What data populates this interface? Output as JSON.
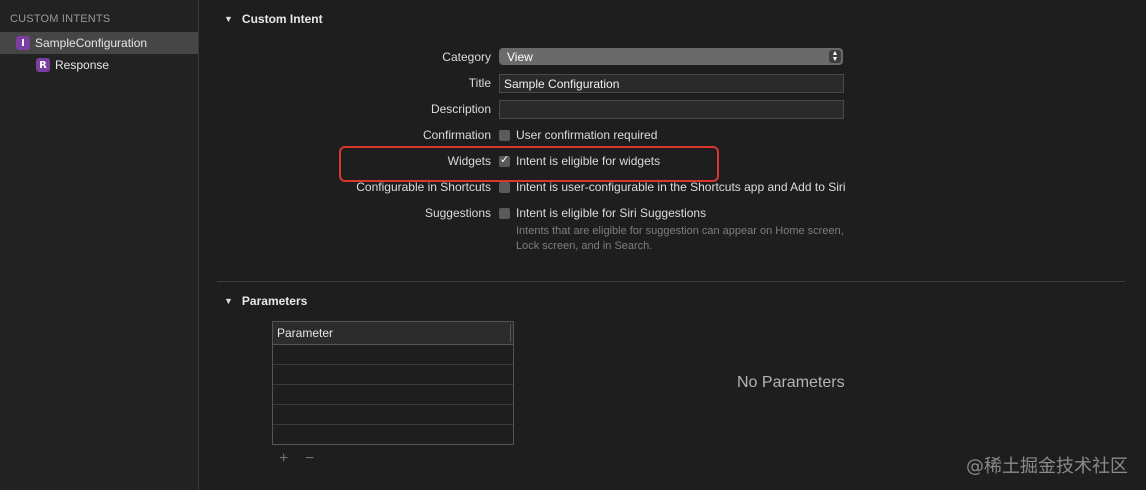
{
  "sidebar": {
    "header": "CUSTOM INTENTS",
    "items": [
      {
        "badge": "I",
        "label": "SampleConfiguration",
        "selected": true
      },
      {
        "badge": "R",
        "label": "Response",
        "selected": false
      }
    ]
  },
  "custom_intent": {
    "section_title": "Custom Intent",
    "category": {
      "label": "Category",
      "value": "View"
    },
    "title": {
      "label": "Title",
      "value": "Sample Configuration"
    },
    "description": {
      "label": "Description",
      "value": ""
    },
    "confirmation": {
      "label": "Confirmation",
      "text": "User confirmation required",
      "checked": false
    },
    "widgets": {
      "label": "Widgets",
      "text": "Intent is eligible for widgets",
      "checked": true
    },
    "configurable": {
      "label": "Configurable in Shortcuts",
      "text": "Intent is user-configurable in the Shortcuts app and Add to Siri",
      "checked": false
    },
    "suggestions": {
      "label": "Suggestions",
      "text": "Intent is eligible for Siri Suggestions",
      "checked": false
    },
    "suggestions_hint_line1": "Intents that are eligible for suggestion can appear on Home screen,",
    "suggestions_hint_line2": "Lock screen, and in Search."
  },
  "parameters": {
    "section_title": "Parameters",
    "column_header": "Parameter",
    "empty_message": "No Parameters",
    "add_label": "+",
    "remove_label": "−"
  },
  "watermark": "@稀土掘金技术社区",
  "colors": {
    "highlight": "#d9372f",
    "badge": "#7a3fa0"
  }
}
